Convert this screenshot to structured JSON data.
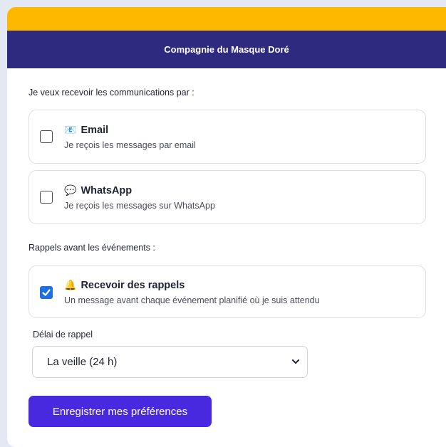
{
  "header": {
    "title": "Compagnie du Masque Doré"
  },
  "communications": {
    "label": "Je veux recevoir les communications par :",
    "options": [
      {
        "icon": "📧",
        "icon_name": "email-icon",
        "title": "Email",
        "description": "Je reçois les messages par email",
        "checked": false
      },
      {
        "icon": "💬",
        "icon_name": "speech-bubble-icon",
        "title": "WhatsApp",
        "description": "Je reçois les messages sur WhatsApp",
        "checked": false
      }
    ]
  },
  "reminders": {
    "label": "Rappels avant les événements :",
    "option": {
      "icon": "🔔",
      "icon_name": "bell-icon",
      "title": "Recevoir des rappels",
      "description": "Un message avant chaque événement planifié où je suis attendu",
      "checked": true
    }
  },
  "delay": {
    "label": "Délai de rappel",
    "selected": "La veille (24 h)"
  },
  "save_button": {
    "label": "Enregistrer mes préférences"
  },
  "colors": {
    "accent_gold": "#ffb800",
    "header_navy": "#2e2a80",
    "button_purple": "#4929e0",
    "checkbox_blue": "#1f6fe0"
  }
}
